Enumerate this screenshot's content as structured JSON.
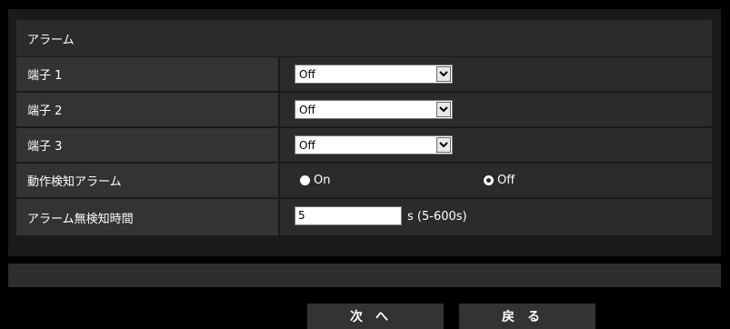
{
  "section_title": "アラーム",
  "rows": [
    {
      "label": "端子 1",
      "value": "Off"
    },
    {
      "label": "端子 2",
      "value": "Off"
    },
    {
      "label": "端子 3",
      "value": "Off"
    }
  ],
  "motion_alarm": {
    "label": "動作検知アラーム",
    "option_on": "On",
    "option_off": "Off",
    "selected": "Off"
  },
  "no_detect_time": {
    "label": "アラーム無検知時間",
    "value": "5",
    "unit": "s (5-600s)"
  },
  "buttons": {
    "next": "次へ",
    "back": "戻る"
  }
}
